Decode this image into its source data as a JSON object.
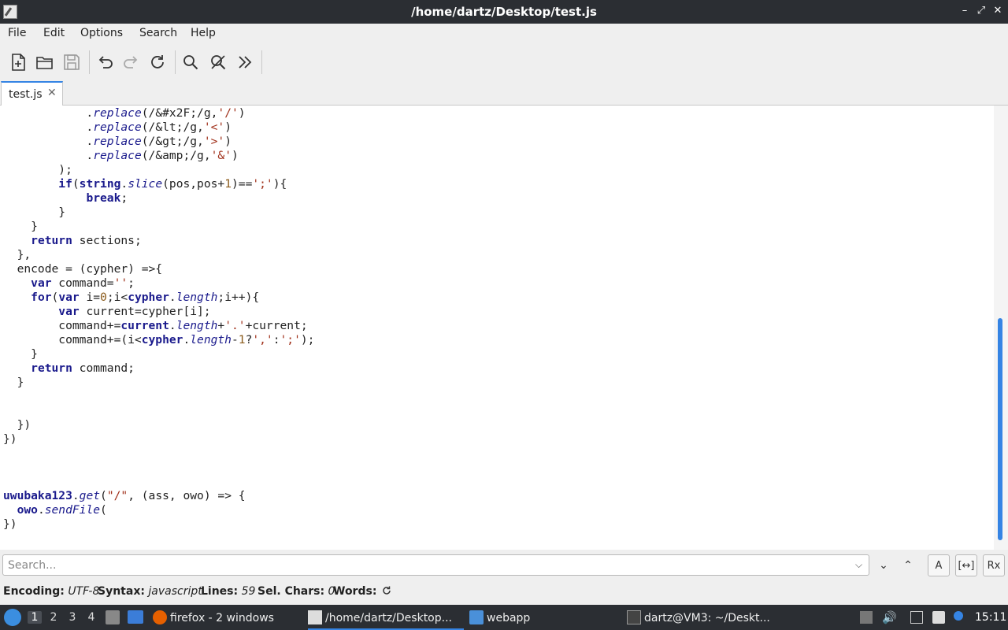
{
  "window": {
    "title": "/home/dartz/Desktop/test.js",
    "controls": [
      "–",
      "⤢",
      "✕"
    ]
  },
  "menu": [
    "File",
    "Edit",
    "Options",
    "Search",
    "Help"
  ],
  "tab": {
    "label": "test.js",
    "close": "✕"
  },
  "code_lines": [
    [
      [
        "op",
        "            ."
      ],
      [
        "fn",
        "replace"
      ],
      [
        "op",
        "(/&#x2F;/g,"
      ],
      [
        "str",
        "'/'"
      ],
      [
        "op",
        ")"
      ]
    ],
    [
      [
        "op",
        "            ."
      ],
      [
        "fn",
        "replace"
      ],
      [
        "op",
        "(/&lt;/g,"
      ],
      [
        "str",
        "'<'"
      ],
      [
        "op",
        ")"
      ]
    ],
    [
      [
        "op",
        "            ."
      ],
      [
        "fn",
        "replace"
      ],
      [
        "op",
        "(/&gt;/g,"
      ],
      [
        "str",
        "'>'"
      ],
      [
        "op",
        ")"
      ]
    ],
    [
      [
        "op",
        "            ."
      ],
      [
        "fn",
        "replace"
      ],
      [
        "op",
        "(/&amp;/g,"
      ],
      [
        "str",
        "'&'"
      ],
      [
        "op",
        ")"
      ]
    ],
    [
      [
        "op",
        "        );"
      ]
    ],
    [
      [
        "op",
        "        "
      ],
      [
        "kw",
        "if"
      ],
      [
        "op",
        "("
      ],
      [
        "kw",
        "string"
      ],
      [
        "op",
        "."
      ],
      [
        "fn",
        "slice"
      ],
      [
        "op",
        "(pos,pos+"
      ],
      [
        "num",
        "1"
      ],
      [
        "op",
        ")=="
      ],
      [
        "str",
        "';'"
      ],
      [
        "op",
        "){"
      ]
    ],
    [
      [
        "op",
        "            "
      ],
      [
        "kw",
        "break"
      ],
      [
        "op",
        ";"
      ]
    ],
    [
      [
        "op",
        "        }"
      ]
    ],
    [
      [
        "op",
        "    }"
      ]
    ],
    [
      [
        "op",
        "    "
      ],
      [
        "kw",
        "return"
      ],
      [
        "op",
        " sections;"
      ]
    ],
    [
      [
        "op",
        "  },"
      ]
    ],
    [
      [
        "op",
        "  encode = (cypher) =>{"
      ]
    ],
    [
      [
        "op",
        "    "
      ],
      [
        "kw",
        "var"
      ],
      [
        "op",
        " command="
      ],
      [
        "str",
        "''"
      ],
      [
        "op",
        ";"
      ]
    ],
    [
      [
        "op",
        "    "
      ],
      [
        "kw",
        "for"
      ],
      [
        "op",
        "("
      ],
      [
        "kw",
        "var"
      ],
      [
        "op",
        " i="
      ],
      [
        "num",
        "0"
      ],
      [
        "op",
        ";i<"
      ],
      [
        "kw",
        "cypher"
      ],
      [
        "op",
        "."
      ],
      [
        "fn",
        "length"
      ],
      [
        "op",
        ";i++){"
      ]
    ],
    [
      [
        "op",
        "        "
      ],
      [
        "kw",
        "var"
      ],
      [
        "op",
        " current=cypher[i];"
      ]
    ],
    [
      [
        "op",
        "        command+="
      ],
      [
        "kw",
        "current"
      ],
      [
        "op",
        "."
      ],
      [
        "fn",
        "length"
      ],
      [
        "op",
        "+"
      ],
      [
        "str",
        "'.'"
      ],
      [
        "op",
        "+current;"
      ]
    ],
    [
      [
        "op",
        "        command+=(i<"
      ],
      [
        "kw",
        "cypher"
      ],
      [
        "op",
        "."
      ],
      [
        "fn",
        "length"
      ],
      [
        "op",
        "-"
      ],
      [
        "num",
        "1"
      ],
      [
        "op",
        "?"
      ],
      [
        "str",
        "','"
      ],
      [
        "op",
        ":"
      ],
      [
        "str",
        "';'"
      ],
      [
        "op",
        ");"
      ]
    ],
    [
      [
        "op",
        "    }"
      ]
    ],
    [
      [
        "op",
        "    "
      ],
      [
        "kw",
        "return"
      ],
      [
        "op",
        " command;"
      ]
    ],
    [
      [
        "op",
        "  }"
      ]
    ],
    [
      [
        "op",
        ""
      ]
    ],
    [
      [
        "op",
        ""
      ]
    ],
    [
      [
        "op",
        "  })"
      ]
    ],
    [
      [
        "op",
        "})"
      ]
    ],
    [
      [
        "op",
        ""
      ]
    ],
    [
      [
        "op",
        ""
      ]
    ],
    [
      [
        "op",
        ""
      ]
    ],
    [
      [
        "kw",
        "uwubaka123"
      ],
      [
        "op",
        "."
      ],
      [
        "fn",
        "get"
      ],
      [
        "op",
        "("
      ],
      [
        "str",
        "\"/\""
      ],
      [
        "op",
        ", (ass, owo) => {"
      ]
    ],
    [
      [
        "op",
        "  "
      ],
      [
        "kw",
        "owo"
      ],
      [
        "op",
        "."
      ],
      [
        "fn",
        "sendFile"
      ],
      [
        "op",
        "("
      ]
    ],
    [
      [
        "op",
        "})"
      ]
    ]
  ],
  "search": {
    "placeholder": "Search...",
    "value": ""
  },
  "search_buttons": {
    "down": "⌄",
    "up": "⌃",
    "match_case": "A",
    "whole_word": "[↔]",
    "regex": "Rx"
  },
  "status": {
    "encoding_label": "Encoding:",
    "encoding_value": "UTF-8",
    "syntax_label": "Syntax:",
    "syntax_value": "javascript",
    "lines_label": "Lines:",
    "lines_value": "59",
    "sel_label": "Sel. Chars:",
    "sel_value": "0",
    "words_label": "Words:"
  },
  "taskbar": {
    "workspaces": [
      "1",
      "2",
      "3",
      "4"
    ],
    "tasks": [
      "firefox - 2 windows",
      "/home/dartz/Desktop...",
      "webapp",
      "dartz@VM3: ~/Deskt..."
    ],
    "clock": "15:11"
  }
}
